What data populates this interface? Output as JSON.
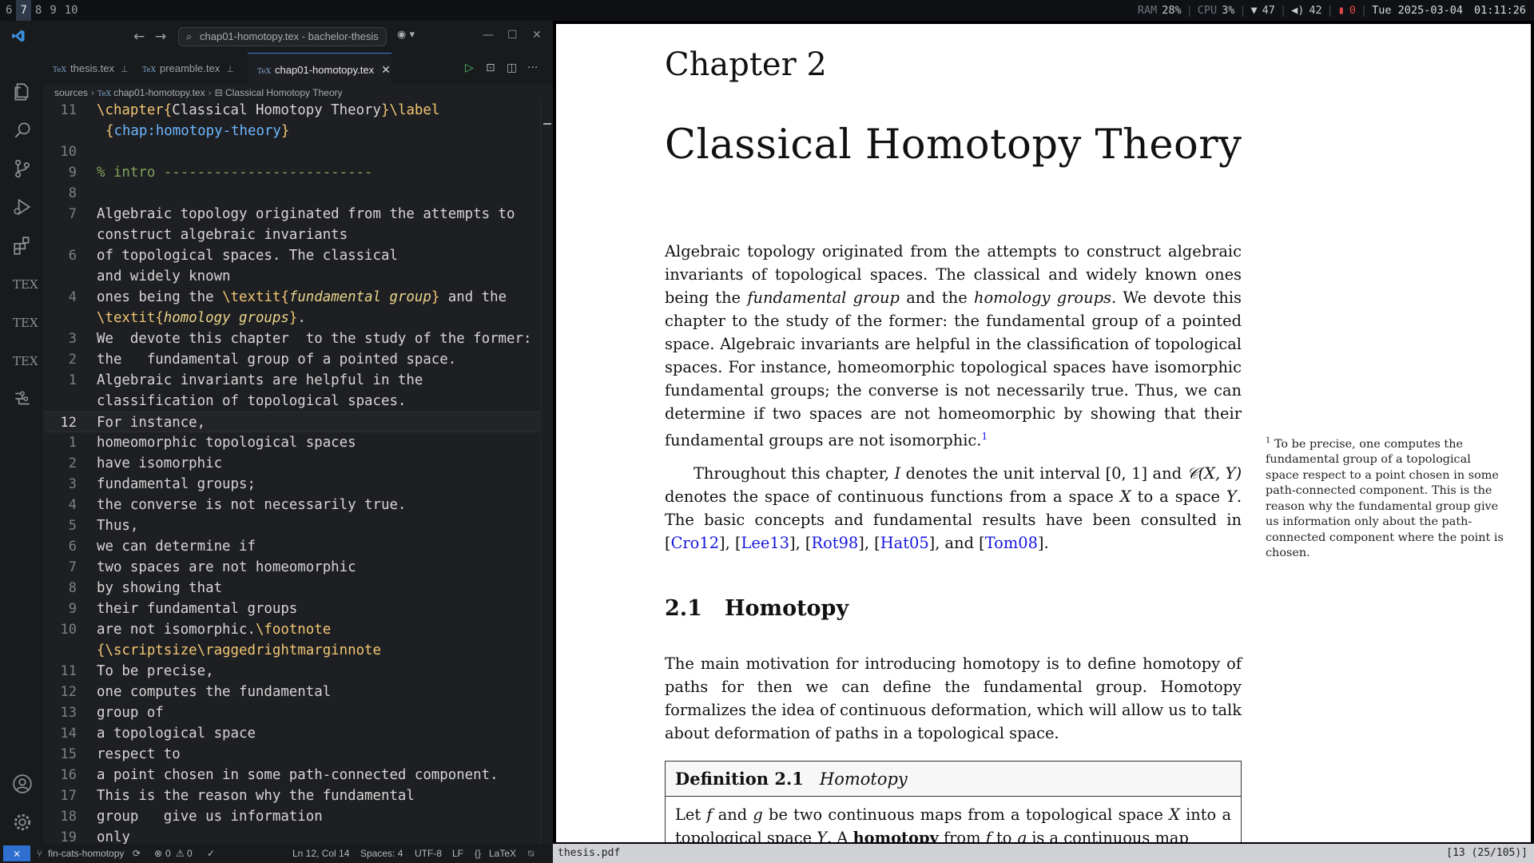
{
  "topbar": {
    "workspaces": [
      "6",
      "7",
      "8",
      "9",
      "10"
    ],
    "active_workspace": "7",
    "ram_label": "RAM",
    "ram_value": "28%",
    "cpu_label": "CPU",
    "cpu_value": "3%",
    "wifi_value": "47",
    "volume_value": "42",
    "notify_value": "0",
    "datetime": "Tue 2025-03-04",
    "time": "01:11:26"
  },
  "vscode": {
    "command_center": "chap01-homotopy.tex - bachelor-thesis",
    "tabs": [
      {
        "label": "thesis.tex"
      },
      {
        "label": "preamble.tex"
      },
      {
        "label": "chap01-homotopy.tex"
      }
    ],
    "breadcrumb": [
      "sources",
      "chap01-homotopy.tex",
      "Classical Homotopy Theory"
    ],
    "tex_label": "TEX",
    "lines": [
      {
        "num": "11",
        "parts": [
          [
            "kw",
            "\\chapter"
          ],
          [
            "br",
            "{"
          ],
          [
            "",
            "Classical Homotopy Theory"
          ],
          [
            "br",
            "}"
          ],
          [
            "kw",
            "\\label"
          ]
        ]
      },
      {
        "num": "",
        "indent": true,
        "parts": [
          [
            "br",
            "{"
          ],
          [
            "arg",
            "chap:homotopy-theory"
          ],
          [
            "br",
            "}"
          ]
        ]
      },
      {
        "num": "10",
        "parts": []
      },
      {
        "num": "9",
        "parts": [
          [
            "cm",
            "% intro -------------------------"
          ]
        ]
      },
      {
        "num": "8",
        "parts": []
      },
      {
        "num": "7",
        "parts": [
          [
            "",
            "Algebraic topology originated from the attempts to"
          ]
        ]
      },
      {
        "num": "",
        "parts": [
          [
            "",
            "construct algebraic invariants"
          ]
        ]
      },
      {
        "num": "6",
        "parts": [
          [
            "",
            "of topological spaces. The classical"
          ]
        ]
      },
      {
        "num": "",
        "parts": [
          [
            "",
            "and widely known"
          ]
        ]
      },
      {
        "num": "4",
        "parts": [
          [
            "",
            "ones being the "
          ],
          [
            "kw",
            "\\textit"
          ],
          [
            "br",
            "{"
          ],
          [
            "it",
            "fundamental group"
          ],
          [
            "br",
            "}"
          ],
          [
            "",
            " and the"
          ]
        ]
      },
      {
        "num": "",
        "parts": [
          [
            "kw",
            "\\textit"
          ],
          [
            "br",
            "{"
          ],
          [
            "it",
            "homology groups"
          ],
          [
            "br",
            "}"
          ],
          [
            "",
            "."
          ]
        ]
      },
      {
        "num": "3",
        "parts": [
          [
            "",
            "We  devote this chapter  to the study of the former:"
          ]
        ]
      },
      {
        "num": "2",
        "parts": [
          [
            "",
            "the   fundamental group of a pointed space."
          ]
        ]
      },
      {
        "num": "1",
        "parts": [
          [
            "",
            "Algebraic invariants are helpful in the"
          ]
        ]
      },
      {
        "num": "",
        "parts": [
          [
            "",
            "classification of topological spaces."
          ]
        ]
      },
      {
        "num": "12",
        "current": true,
        "parts": [
          [
            "",
            "For instance,"
          ]
        ]
      },
      {
        "num": "1",
        "parts": [
          [
            "",
            "homeomorphic topological spaces"
          ]
        ]
      },
      {
        "num": "2",
        "parts": [
          [
            "",
            "have isomorphic"
          ]
        ]
      },
      {
        "num": "3",
        "parts": [
          [
            "",
            "fundamental groups;"
          ]
        ]
      },
      {
        "num": "4",
        "parts": [
          [
            "",
            "the converse is not necessarily true."
          ]
        ]
      },
      {
        "num": "5",
        "parts": [
          [
            "",
            "Thus,"
          ]
        ]
      },
      {
        "num": "6",
        "parts": [
          [
            "",
            "we can determine if"
          ]
        ]
      },
      {
        "num": "7",
        "parts": [
          [
            "",
            "two spaces are not homeomorphic"
          ]
        ]
      },
      {
        "num": "8",
        "parts": [
          [
            "",
            "by showing that"
          ]
        ]
      },
      {
        "num": "9",
        "parts": [
          [
            "",
            "their fundamental groups"
          ]
        ]
      },
      {
        "num": "10",
        "parts": [
          [
            "",
            "are not isomorphic."
          ],
          [
            "kw",
            "\\footnote"
          ]
        ]
      },
      {
        "num": "",
        "parts": [
          [
            "br",
            "{"
          ],
          [
            "kw",
            "\\scriptsize\\raggedrightmarginnote"
          ]
        ]
      },
      {
        "num": "11",
        "parts": [
          [
            "",
            "To be precise,"
          ]
        ]
      },
      {
        "num": "12",
        "parts": [
          [
            "",
            "one computes the fundamental"
          ]
        ]
      },
      {
        "num": "13",
        "parts": [
          [
            "",
            "group of"
          ]
        ]
      },
      {
        "num": "14",
        "parts": [
          [
            "",
            "a topological space"
          ]
        ]
      },
      {
        "num": "15",
        "parts": [
          [
            "",
            "respect to"
          ]
        ]
      },
      {
        "num": "16",
        "parts": [
          [
            "",
            "a point chosen in some path-connected component."
          ]
        ]
      },
      {
        "num": "17",
        "parts": [
          [
            "",
            "This is the reason why the fundamental"
          ]
        ]
      },
      {
        "num": "18",
        "parts": [
          [
            "",
            "group   give us information"
          ]
        ]
      },
      {
        "num": "19",
        "parts": [
          [
            "",
            "only"
          ]
        ]
      }
    ],
    "line_number_5": "5",
    "status": {
      "branch": "fin-cats-homotopy",
      "errors": "0",
      "warnings": "0",
      "position": "Ln 12, Col 14",
      "spaces": "Spaces: 4",
      "encoding": "UTF-8",
      "eol": "LF",
      "language": "LaTeX"
    }
  },
  "pdf": {
    "chapter_number": "Chapter 2",
    "chapter_title": "Classical Homotopy Theory",
    "para1_a": "Algebraic topology originated from the attempts to construct algebraic invariants of topological spaces. The classical and widely known ones being the ",
    "para1_it1": "fundamental group",
    "para1_b": " and the ",
    "para1_it2": "homology groups",
    "para1_c": ". We devote this chapter to the study of the former: the fundamental group of a pointed space. Algebraic invariants are helpful in the classification of topological spaces. For instance, homeomorphic topological spaces have isomorphic fundamental groups; the converse is not necessarily true. Thus, we can determine if two spaces are not homeomorphic by showing that their fundamental groups are not isomorphic.",
    "footnote_mark": "1",
    "para2_a": "Throughout this chapter, ",
    "para2_I": "I",
    "para2_b": " denotes the unit interval [0, 1] and ",
    "para2_C": "𝒞(X, Y)",
    "para2_c": " denotes the space of continuous functions from a space ",
    "para2_X": "X",
    "para2_d": " to a space ",
    "para2_Y": "Y",
    "para2_e": ". The basic concepts and fundamental results have been consulted in ",
    "cites": [
      "Cro12",
      "Lee13",
      "Rot98",
      "Hat05",
      "Tom08"
    ],
    "section_number": "2.1",
    "section_title": "Homotopy",
    "para3": "The main motivation for introducing homotopy is to define homotopy of paths for then we can define the fundamental group. Homotopy formalizes the idea of continuous deformation, which will allow us to talk about deformation of paths in a topological space.",
    "footnote_text": "To be precise, one computes the fundamental group of a topological space respect to a point chosen in some path-connected component. This is the reason why the fundamental group give us information only about the path-connected component where the point is chosen.",
    "def_label": "Definition 2.1",
    "def_name": "Homotopy",
    "def_body_a": "Let ",
    "def_f": "f",
    "def_body_b": " and ",
    "def_g": "g",
    "def_body_c": " be two continuous maps from a topological space ",
    "def_X": "X",
    "def_body_d": " into a topological space ",
    "def_Y": "Y",
    "def_body_e": ". A ",
    "def_bold": "homotopy",
    "def_body_f": " from ",
    "def_body_g": " to ",
    "def_body_h": " is a continuous map",
    "filename": "thesis.pdf",
    "page_indicator": "[13 (25/105)]"
  }
}
